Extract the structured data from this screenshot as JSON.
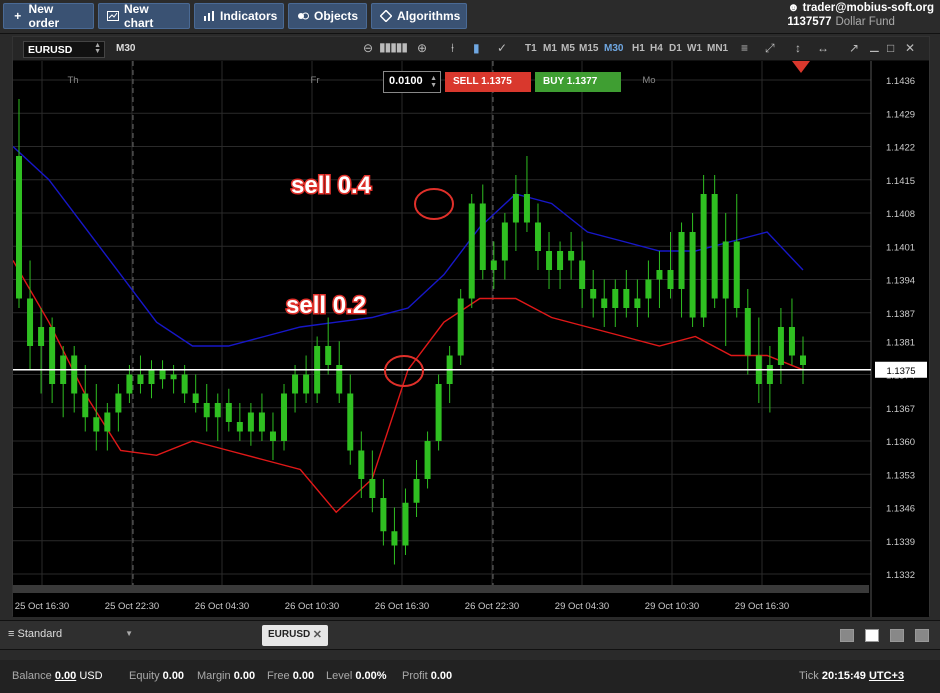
{
  "toolbar": {
    "new_order": "New order",
    "new_chart": "New chart",
    "indicators": "Indicators",
    "objects": "Objects",
    "algorithms": "Algorithms"
  },
  "account": {
    "user": "trader@mobius-soft.org",
    "id": "1137577",
    "fund": "Dollar Fund"
  },
  "chart": {
    "symbol": "EURUSD",
    "timeframe": "M30",
    "timeframes": [
      "T1",
      "M1",
      "M5",
      "M15",
      "M30",
      "H1",
      "H4",
      "D1",
      "W1",
      "MN1"
    ],
    "active_timeframe": "M30",
    "day_labels": [
      "Th",
      "Fr",
      "Mo"
    ],
    "current_price": "1.1375",
    "annotations": [
      "sell 0.4",
      "sell 0.2"
    ],
    "colors": {
      "up_candle": "#2fbf21",
      "upper_band": "#1717c8",
      "lower_band": "#e01818",
      "price_line": "#ffffff",
      "grid": "#2a2a2a"
    }
  },
  "order": {
    "lot": "0.0100",
    "sell_label": "SELL",
    "sell_price": "1.1375",
    "buy_label": "BUY",
    "buy_price": "1.1377"
  },
  "chart_data": {
    "type": "candlestick",
    "ylim": [
      1.1328,
      1.144
    ],
    "y_ticks": [
      "1.1436",
      "1.1429",
      "1.1422",
      "1.1415",
      "1.1408",
      "1.1401",
      "1.1394",
      "1.1387",
      "1.1381",
      "1.1374",
      "1.1367",
      "1.1360",
      "1.1353",
      "1.1346",
      "1.1339",
      "1.1332"
    ],
    "x_ticks": [
      "25 Oct 16:30",
      "25 Oct 22:30",
      "26 Oct 04:30",
      "26 Oct 10:30",
      "26 Oct 16:30",
      "26 Oct 22:30",
      "29 Oct 04:30",
      "29 Oct 10:30",
      "29 Oct 16:30"
    ],
    "candles": [
      [
        1.142,
        1.1432,
        1.1388,
        1.139
      ],
      [
        1.139,
        1.1398,
        1.1375,
        1.138
      ],
      [
        1.138,
        1.1388,
        1.137,
        1.1384
      ],
      [
        1.1384,
        1.1386,
        1.1368,
        1.1372
      ],
      [
        1.1372,
        1.138,
        1.1365,
        1.1378
      ],
      [
        1.1378,
        1.138,
        1.1366,
        1.137
      ],
      [
        1.137,
        1.1376,
        1.1362,
        1.1365
      ],
      [
        1.1365,
        1.1372,
        1.1358,
        1.1362
      ],
      [
        1.1362,
        1.1368,
        1.1358,
        1.1366
      ],
      [
        1.1366,
        1.1372,
        1.1362,
        1.137
      ],
      [
        1.137,
        1.1376,
        1.1368,
        1.1374
      ],
      [
        1.1374,
        1.1378,
        1.137,
        1.1372
      ],
      [
        1.1372,
        1.1377,
        1.1369,
        1.1375
      ],
      [
        1.1375,
        1.1377,
        1.1371,
        1.1373
      ],
      [
        1.1373,
        1.1376,
        1.137,
        1.1374
      ],
      [
        1.1374,
        1.1376,
        1.1368,
        1.137
      ],
      [
        1.137,
        1.1374,
        1.1366,
        1.1368
      ],
      [
        1.1368,
        1.1372,
        1.1362,
        1.1365
      ],
      [
        1.1365,
        1.137,
        1.136,
        1.1368
      ],
      [
        1.1368,
        1.1371,
        1.1362,
        1.1364
      ],
      [
        1.1364,
        1.1368,
        1.136,
        1.1362
      ],
      [
        1.1362,
        1.1368,
        1.1359,
        1.1366
      ],
      [
        1.1366,
        1.137,
        1.136,
        1.1362
      ],
      [
        1.1362,
        1.1366,
        1.1356,
        1.136
      ],
      [
        1.136,
        1.1372,
        1.1358,
        1.137
      ],
      [
        1.137,
        1.1376,
        1.1366,
        1.1374
      ],
      [
        1.1374,
        1.1378,
        1.1368,
        1.137
      ],
      [
        1.137,
        1.1382,
        1.1368,
        1.138
      ],
      [
        1.138,
        1.1386,
        1.1374,
        1.1376
      ],
      [
        1.1376,
        1.1381,
        1.1368,
        1.137
      ],
      [
        1.137,
        1.1374,
        1.1355,
        1.1358
      ],
      [
        1.1358,
        1.1362,
        1.1348,
        1.1352
      ],
      [
        1.1352,
        1.1358,
        1.1345,
        1.1348
      ],
      [
        1.1348,
        1.1352,
        1.1338,
        1.1341
      ],
      [
        1.1341,
        1.1346,
        1.1334,
        1.1338
      ],
      [
        1.1338,
        1.135,
        1.1336,
        1.1347
      ],
      [
        1.1347,
        1.1356,
        1.1344,
        1.1352
      ],
      [
        1.1352,
        1.1362,
        1.135,
        1.136
      ],
      [
        1.136,
        1.1374,
        1.1358,
        1.1372
      ],
      [
        1.1372,
        1.138,
        1.1368,
        1.1378
      ],
      [
        1.1378,
        1.1392,
        1.1376,
        1.139
      ],
      [
        1.139,
        1.1412,
        1.1388,
        1.141
      ],
      [
        1.141,
        1.1414,
        1.1394,
        1.1396
      ],
      [
        1.1396,
        1.1402,
        1.1392,
        1.1398
      ],
      [
        1.1398,
        1.1408,
        1.1394,
        1.1406
      ],
      [
        1.1406,
        1.1416,
        1.14,
        1.1412
      ],
      [
        1.1412,
        1.142,
        1.1404,
        1.1406
      ],
      [
        1.1406,
        1.141,
        1.1396,
        1.14
      ],
      [
        1.14,
        1.1404,
        1.1392,
        1.1396
      ],
      [
        1.1396,
        1.1402,
        1.1392,
        1.14
      ],
      [
        1.14,
        1.1404,
        1.1394,
        1.1398
      ],
      [
        1.1398,
        1.1402,
        1.1388,
        1.1392
      ],
      [
        1.1392,
        1.1396,
        1.1386,
        1.139
      ],
      [
        1.139,
        1.1394,
        1.1384,
        1.1388
      ],
      [
        1.1388,
        1.1394,
        1.1384,
        1.1392
      ],
      [
        1.1392,
        1.1396,
        1.1386,
        1.1388
      ],
      [
        1.1388,
        1.1394,
        1.1384,
        1.139
      ],
      [
        1.139,
        1.1398,
        1.1386,
        1.1394
      ],
      [
        1.1394,
        1.14,
        1.1388,
        1.1396
      ],
      [
        1.1396,
        1.1404,
        1.139,
        1.1392
      ],
      [
        1.1392,
        1.1406,
        1.1386,
        1.1404
      ],
      [
        1.1404,
        1.1408,
        1.1384,
        1.1386
      ],
      [
        1.1386,
        1.1416,
        1.1384,
        1.1412
      ],
      [
        1.1412,
        1.1416,
        1.1388,
        1.139
      ],
      [
        1.139,
        1.1408,
        1.138,
        1.1402
      ],
      [
        1.1402,
        1.1412,
        1.1386,
        1.1388
      ],
      [
        1.1388,
        1.1392,
        1.1374,
        1.1378
      ],
      [
        1.1378,
        1.1386,
        1.1368,
        1.1372
      ],
      [
        1.1372,
        1.138,
        1.1366,
        1.1376
      ],
      [
        1.1376,
        1.1388,
        1.1372,
        1.1384
      ],
      [
        1.1384,
        1.139,
        1.1376,
        1.1378
      ],
      [
        1.1378,
        1.1382,
        1.1372,
        1.1376
      ]
    ],
    "upper_band": [
      1.1422,
      1.1415,
      1.1405,
      1.1395,
      1.1385,
      1.138,
      1.138,
      1.1382,
      1.1384,
      1.1385,
      1.1386,
      1.1388,
      1.1395,
      1.1405,
      1.1412,
      1.141,
      1.1404,
      1.1402,
      1.14,
      1.14,
      1.1402,
      1.1404,
      1.1396
    ],
    "lower_band": [
      1.1398,
      1.1385,
      1.137,
      1.1358,
      1.1357,
      1.136,
      1.1358,
      1.1356,
      1.1354,
      1.1345,
      1.1352,
      1.1375,
      1.1385,
      1.139,
      1.139,
      1.1386,
      1.1384,
      1.1382,
      1.138,
      1.1382,
      1.1378,
      1.1378,
      1.1375
    ]
  },
  "tabs": {
    "workspace": "Standard",
    "chart_tab": "EURUSD"
  },
  "status": {
    "balance_label": "Balance",
    "balance": "0.00",
    "currency": "USD",
    "equity_label": "Equity",
    "equity": "0.00",
    "margin_label": "Margin",
    "margin": "0.00",
    "free_label": "Free",
    "free": "0.00",
    "level_label": "Level",
    "level": "0.00%",
    "profit_label": "Profit",
    "profit": "0.00",
    "tick_label": "Tick",
    "time": "20:15:49",
    "tz": "UTC+3"
  }
}
